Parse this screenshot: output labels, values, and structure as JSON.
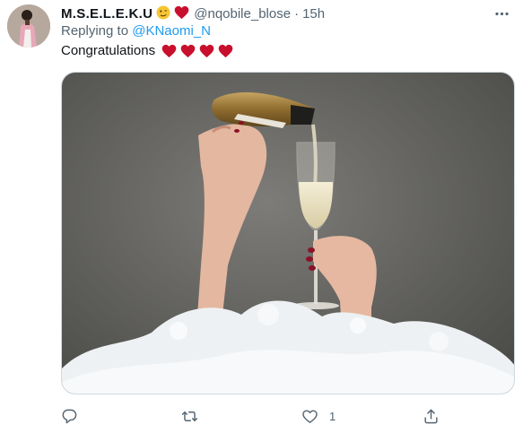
{
  "tweet": {
    "display_name": "M.S.E.L.E.K.U",
    "name_emojis": [
      "smirk-face",
      "red-heart"
    ],
    "handle": "@nqobile_blose",
    "separator": "·",
    "time": "15h",
    "replying_prefix": "Replying to",
    "replying_to": "@KNaomi_N",
    "text": "Congratulations",
    "text_hearts": 4,
    "heart_color": "#c8102e",
    "media_description": "photo"
  },
  "actions": {
    "reply_count": "",
    "retweet_count": "",
    "like_count": "1",
    "share_count": ""
  },
  "icons": [
    "more-icon",
    "reply-icon",
    "retweet-icon",
    "like-icon",
    "share-icon"
  ],
  "colors": {
    "link": "#1d9bf0",
    "secondary": "#536471",
    "border": "#cfd9de"
  }
}
